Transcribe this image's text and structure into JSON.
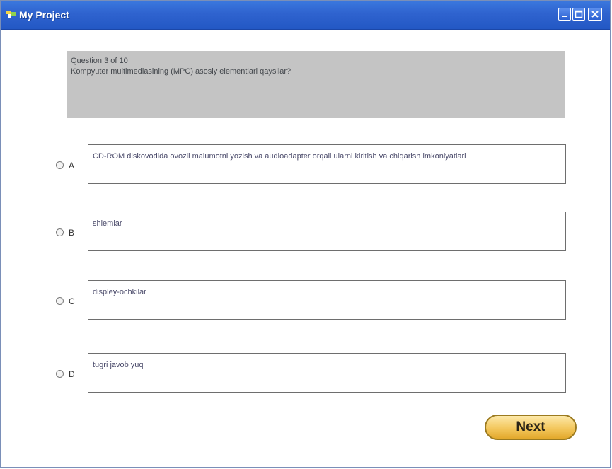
{
  "window": {
    "title": "My Project"
  },
  "question": {
    "number": "Question 3 of 10",
    "text": "Kompyuter multimediasining (MPC) asosiy elementlari qaysilar?"
  },
  "options": [
    {
      "letter": "A",
      "text": "CD-ROM diskovodida ovozli malumotni yozish va audioadapter orqali ularni kiritish va chiqarish imkoniyatlari"
    },
    {
      "letter": "B",
      "text": "shlemlar"
    },
    {
      "letter": "C",
      "text": "displey-ochkilar"
    },
    {
      "letter": "D",
      "text": "tugri javob yuq"
    }
  ],
  "buttons": {
    "next": "Next"
  },
  "colors": {
    "titlebar": "#2f63cf",
    "question_box": "#c4c4c4",
    "next_button": "#f3c75d"
  }
}
